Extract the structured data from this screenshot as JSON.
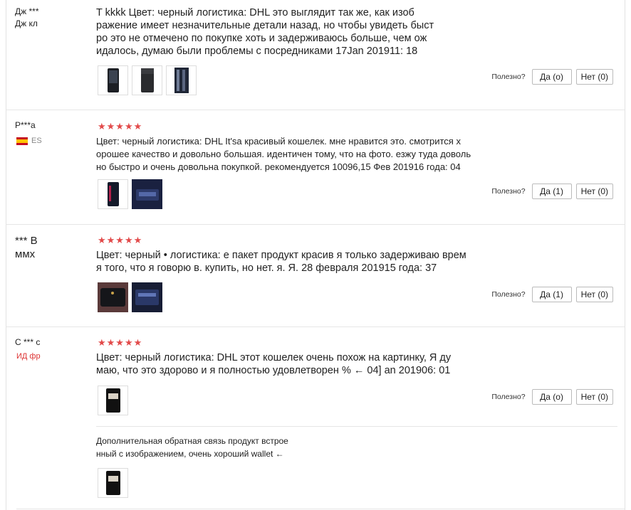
{
  "reviews": [
    {
      "author_line1": "Дж ***",
      "author_line2": "Дж кл",
      "text": "T kkkk Цвет: черный логистика: DHL это выглядит так же, как изоб\nражение имеет незначительные детали назад, но чтобы увидеть быст\nро это не отмечено по покупке хоть и задерживаюсь больше, чем ож\nидалось, думаю были проблемы с посредниками 17Jan 201911: 18",
      "helpful_label": "Полезно?",
      "yes_label": "Да (o)",
      "no_label": "Нет (0)"
    },
    {
      "author_line1": "P***a",
      "country": "ES",
      "stars": "★★★★★",
      "text": "Цвет: черный логистика: DHL It'sa красивый кошелек. мне нравится это. смотрится х\nорошее качество и довольно большая. идентичен тому, что на фото. езжу туда доволь\nно быстро и очень довольна покупкой. рекомендуется 10096,15 Фев 201916 года: 04",
      "helpful_label": "Полезно?",
      "yes_label": "Да (1)",
      "no_label": "Нет (0)"
    },
    {
      "author_line1": "*** В",
      "author_line2": "ммх",
      "stars": "★★★★★",
      "text": "Цвет: черный • логистика: е пакет продукт красив я только задерживаю врем\nя того, что я говорю в. купить, но нет. я. Я. 28 февраля 201915 года: 37",
      "helpful_label": "Полезно?",
      "yes_label": "Да (1)",
      "no_label": "Нет (0)"
    },
    {
      "author_line1": "С *** с",
      "country": "ИД фр",
      "stars": "★★★★★",
      "text": "Цвет: черный логистика: DHL этот кошелек очень похож на картинку, Я ду\nмаю, что это здорово и я полностью удовлетворен % ← 04] an 201906: 01",
      "helpful_label": "Полезно?",
      "yes_label": "Да (o)",
      "no_label": "Нет (0)",
      "additional_text": "Дополнительная обратная связь продукт встрое\nнный с изображением, очень хороший wallet ←"
    }
  ],
  "colors": {
    "star": "#e24a4a",
    "flag_red": "#c60b1e",
    "flag_yellow": "#ffc400"
  }
}
